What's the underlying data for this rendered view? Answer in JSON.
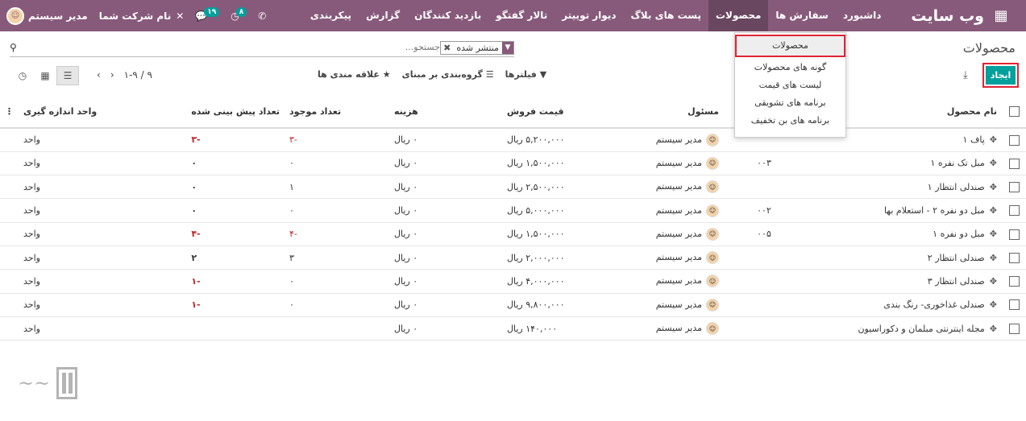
{
  "topbar": {
    "brand": "وب سایت",
    "menu": [
      "داشبورد",
      "سفارش ها",
      "محصولات",
      "پست های بلاگ",
      "دیوار توییتر",
      "تالار گفتگو",
      "بازدید کنندگان",
      "گزارش",
      "پیکربندی"
    ],
    "active_menu": "محصولات",
    "user": "مدیر سیستم",
    "company": "نام شرکت شما",
    "messages_badge": "۱۹",
    "activities_badge": "۸"
  },
  "control_panel": {
    "title": "محصولات",
    "create_label": "ایجاد",
    "facet_label": "منتشر شده",
    "search_placeholder": "جستجو...",
    "filters_label": "فیلترها",
    "groupby_label": "گروه‌بندی بر مبنای",
    "favorites_label": "علاقه مندی ها",
    "pager": "۱-۹ / ۹"
  },
  "dropdown": [
    "محصولات",
    "گونه های محصولات",
    "لیست های قیمت",
    "برنامه های تشویقی",
    "برنامه های بن تخفیف"
  ],
  "table": {
    "headers": [
      "نام محصول",
      "",
      "مسئول",
      "قیمت فروش",
      "هزینه",
      "تعداد موجود",
      "تعداد پیش بینی شده",
      "واحد اندازه گیری"
    ],
    "rows": [
      {
        "name": "پاف ۱",
        "ref": "",
        "owner": "مدیر سیستم",
        "price": "۵,۲۰۰,۰۰۰ ریال",
        "cost": "۰ ریال",
        "qty": "-۳",
        "forecast": "-۳",
        "uom": "واحد",
        "qty_neg": true,
        "fc_neg": true
      },
      {
        "name": "مبل تک نفره ۱",
        "ref": "۰۰۳",
        "owner": "مدیر سیستم",
        "price": "۱,۵۰۰,۰۰۰ ریال",
        "cost": "۰ ریال",
        "qty": "۰",
        "forecast": "۰",
        "uom": "واحد",
        "qty_neg": false,
        "fc_neg": false
      },
      {
        "name": "صندلی انتظار ۱",
        "ref": "",
        "owner": "مدیر سیستم",
        "price": "۲,۵۰۰,۰۰۰ ریال",
        "cost": "۰ ریال",
        "qty": "۱",
        "forecast": "۰",
        "uom": "واحد",
        "qty_neg": false,
        "fc_neg": false
      },
      {
        "name": "مبل دو نفره ۲ - استعلام بها",
        "ref": "۰۰۲",
        "owner": "مدیر سیستم",
        "price": "۵,۰۰۰,۰۰۰ ریال",
        "cost": "۰ ریال",
        "qty": "۰",
        "forecast": "۰",
        "uom": "واحد",
        "qty_neg": false,
        "fc_neg": false
      },
      {
        "name": "مبل دو نفره ۱",
        "ref": "۰۰۵",
        "owner": "مدیر سیستم",
        "price": "۱,۵۰۰,۰۰۰ ریال",
        "cost": "۰ ریال",
        "qty": "-۴",
        "forecast": "-۴",
        "uom": "واحد",
        "qty_neg": true,
        "fc_neg": true
      },
      {
        "name": "صندلی انتظار ۲",
        "ref": "",
        "owner": "مدیر سیستم",
        "price": "۲,۰۰۰,۰۰۰ ریال",
        "cost": "۰ ریال",
        "qty": "۳",
        "forecast": "۲",
        "uom": "واحد",
        "qty_neg": false,
        "fc_neg": false
      },
      {
        "name": "صندلی انتظار ۳",
        "ref": "",
        "owner": "مدیر سیستم",
        "price": "۴,۰۰۰,۰۰۰ ریال",
        "cost": "۰ ریال",
        "qty": "۰",
        "forecast": "-۱",
        "uom": "واحد",
        "qty_neg": false,
        "fc_neg": true
      },
      {
        "name": "صندلی غذاخوری- رنگ بندی",
        "ref": "",
        "owner": "مدیر سیستم",
        "price": "۹,۸۰۰,۰۰۰ ریال",
        "cost": "۰ ریال",
        "qty": "۰",
        "forecast": "-۱",
        "uom": "واحد",
        "qty_neg": false,
        "fc_neg": true
      },
      {
        "name": "مجله اینترنتی مبلمان و دکوراسیون",
        "ref": "",
        "owner": "مدیر سیستم",
        "price": "۱۴۰,۰۰۰ ریال",
        "cost": "۰ ریال",
        "qty": "",
        "forecast": "",
        "uom": "واحد",
        "qty_neg": false,
        "fc_neg": false
      }
    ]
  },
  "colors": {
    "brand": "#875a7b",
    "primary": "#00a09d",
    "highlight": "#e12333",
    "negative": "#c0272d"
  }
}
